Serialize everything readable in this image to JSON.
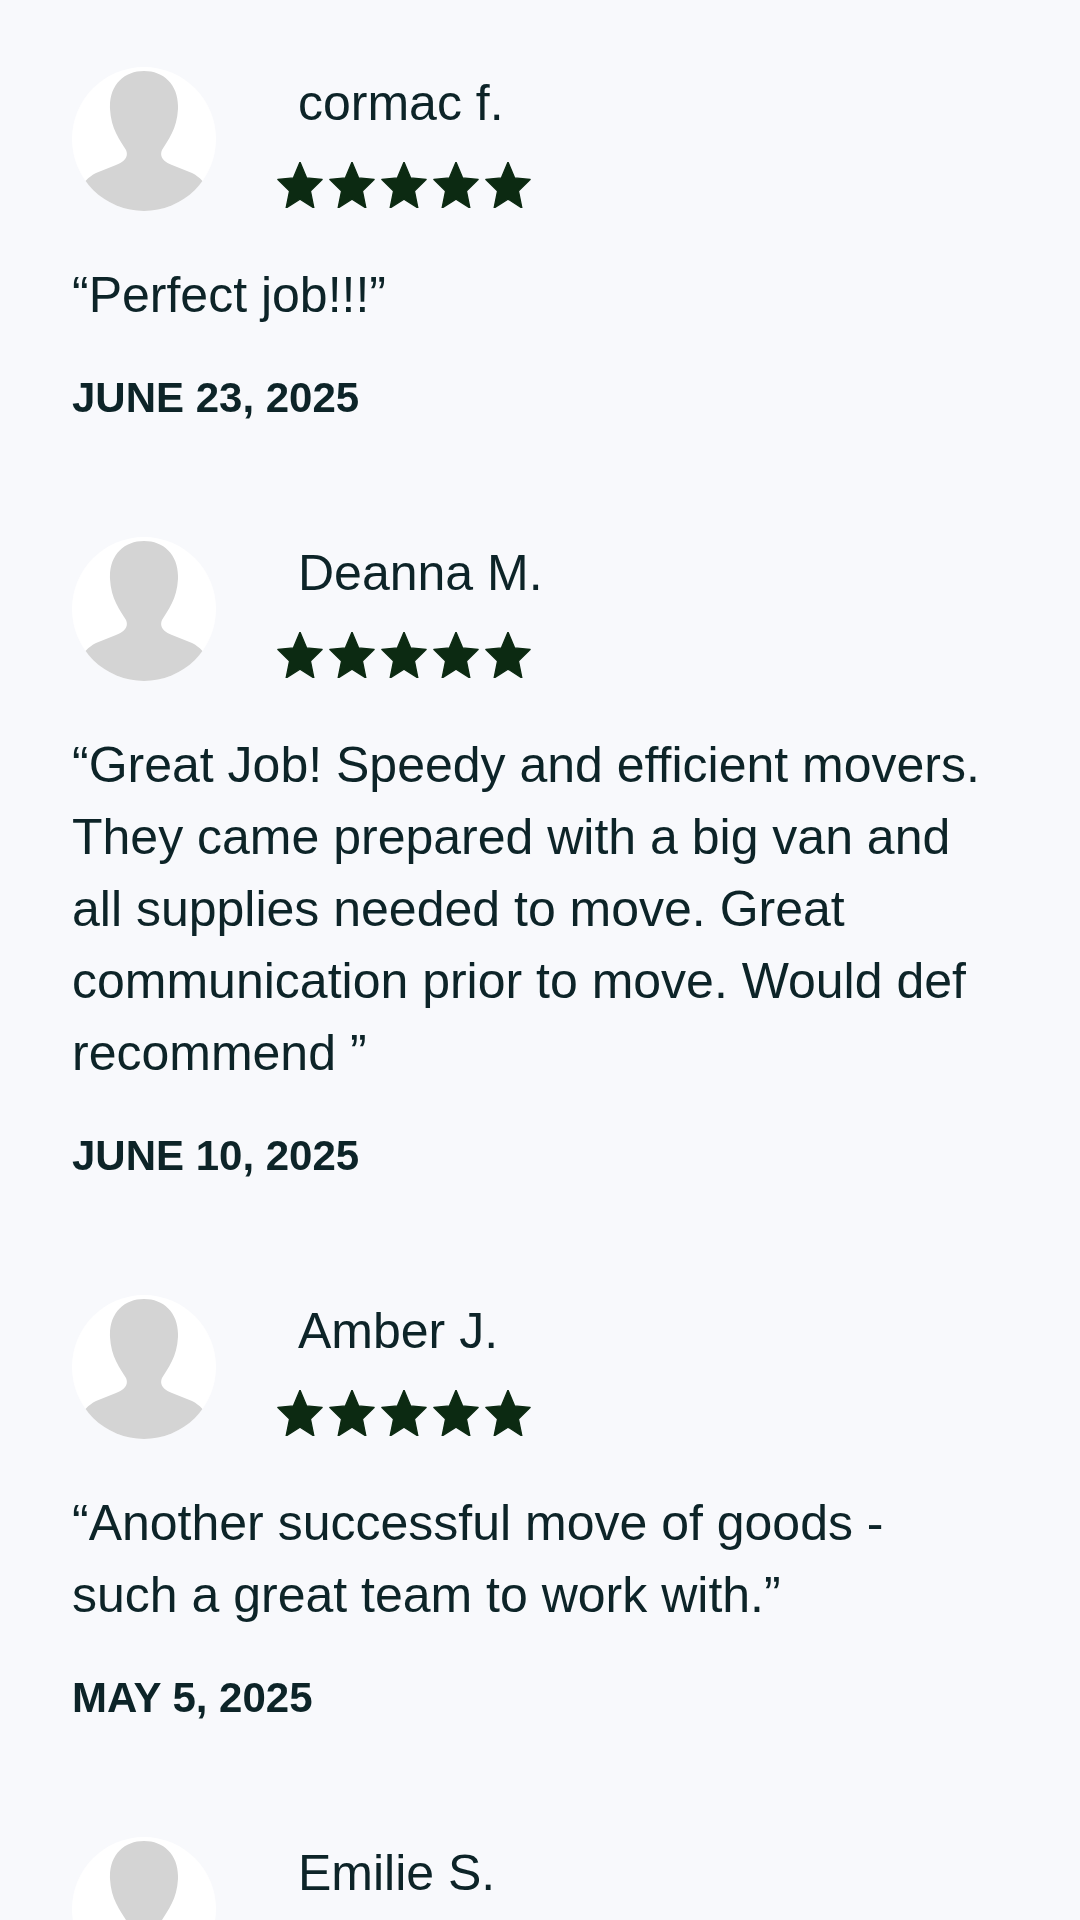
{
  "reviews": [
    {
      "name": "cormac f.",
      "stars": 5,
      "text": "“Perfect job!!!”",
      "date": "JUNE 23, 2025"
    },
    {
      "name": "Deanna M.",
      "stars": 5,
      "text": "“Great Job! Speedy and efficient movers. They came prepared with a big van and all supplies needed to move. Great communication prior to move. Would def recommend ”",
      "date": "JUNE 10, 2025"
    },
    {
      "name": "Amber J.",
      "stars": 5,
      "text": "“Another successful move of goods - such a great team to work with.”",
      "date": "MAY 5, 2025"
    },
    {
      "name": "Emilie S."
    }
  ]
}
